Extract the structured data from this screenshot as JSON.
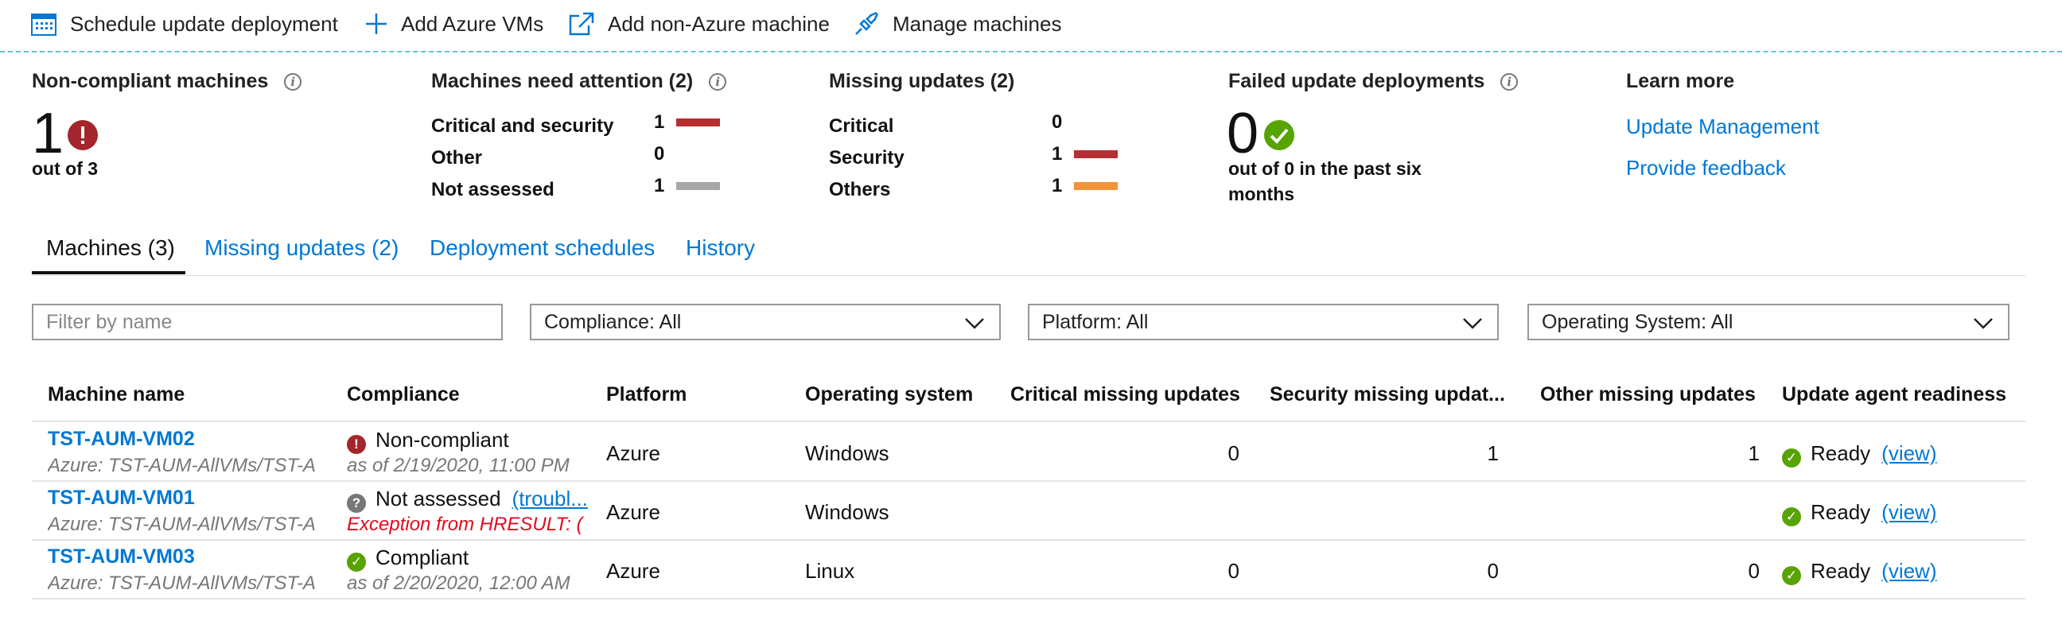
{
  "toolbar": {
    "schedule_label": "Schedule update deployment",
    "add_azure_label": "Add Azure VMs",
    "add_nonazure_label": "Add non-Azure machine",
    "manage_label": "Manage machines"
  },
  "summary": {
    "noncompliant": {
      "title": "Non-compliant machines",
      "count": "1",
      "subtitle": "out of 3"
    },
    "attention": {
      "title": "Machines need attention (2)",
      "rows": [
        {
          "label": "Critical and security",
          "value": "1",
          "bar_color": "#b52e31"
        },
        {
          "label": "Other",
          "value": "0",
          "bar_color": ""
        },
        {
          "label": "Not assessed",
          "value": "1",
          "bar_color": "#a6a6a6"
        }
      ]
    },
    "missing": {
      "title": "Missing updates (2)",
      "rows": [
        {
          "label": "Critical",
          "value": "0",
          "bar_color": ""
        },
        {
          "label": "Security",
          "value": "1",
          "bar_color": "#b52e31"
        },
        {
          "label": "Others",
          "value": "1",
          "bar_color": "#f39237"
        }
      ]
    },
    "failed": {
      "title": "Failed update deployments",
      "count": "0",
      "subtitle_line1": "out of 0 in the past six",
      "subtitle_line2": "months"
    },
    "learn": {
      "title": "Learn more",
      "link1": "Update Management",
      "link2": "Provide feedback"
    }
  },
  "tabs": [
    {
      "label": "Machines (3)",
      "active": true
    },
    {
      "label": "Missing updates (2)",
      "active": false
    },
    {
      "label": "Deployment schedules",
      "active": false
    },
    {
      "label": "History",
      "active": false
    }
  ],
  "filters": {
    "name_placeholder": "Filter by name",
    "compliance": "Compliance: All",
    "platform": "Platform: All",
    "os": "Operating System: All"
  },
  "table": {
    "headers": [
      "Machine name",
      "Compliance",
      "Platform",
      "Operating system",
      "Critical missing updates",
      "Security missing updat...",
      "Other missing updates",
      "Update agent readiness"
    ],
    "rows": [
      {
        "name": "TST-AUM-VM02",
        "sub": "Azure: TST-AUM-AllVMs/TST-A",
        "compliance": "Non-compliant",
        "compliance_sub": "as of 2/19/2020, 11:00 PM",
        "compliance_link": "",
        "platform": "Azure",
        "os": "Windows",
        "critical": "0",
        "security": "1",
        "other": "1",
        "readiness": "Ready",
        "view": "(view)"
      },
      {
        "name": "TST-AUM-VM01",
        "sub": "Azure: TST-AUM-AllVMs/TST-A",
        "compliance": "Not assessed",
        "compliance_sub": "Exception from HRESULT: (",
        "compliance_link": "(troubl...",
        "platform": "Azure",
        "os": "Windows",
        "critical": "",
        "security": "",
        "other": "",
        "readiness": "Ready",
        "view": "(view)"
      },
      {
        "name": "TST-AUM-VM03",
        "sub": "Azure: TST-AUM-AllVMs/TST-A",
        "compliance": "Compliant",
        "compliance_sub": "as of 2/20/2020, 12:00 AM",
        "compliance_link": "",
        "platform": "Azure",
        "os": "Linux",
        "critical": "0",
        "security": "0",
        "other": "0",
        "readiness": "Ready",
        "view": "(view)"
      }
    ]
  },
  "colors": {
    "accent": "#0078d4",
    "error": "#a4262c",
    "success": "#57a300",
    "unknown": "#797775"
  }
}
